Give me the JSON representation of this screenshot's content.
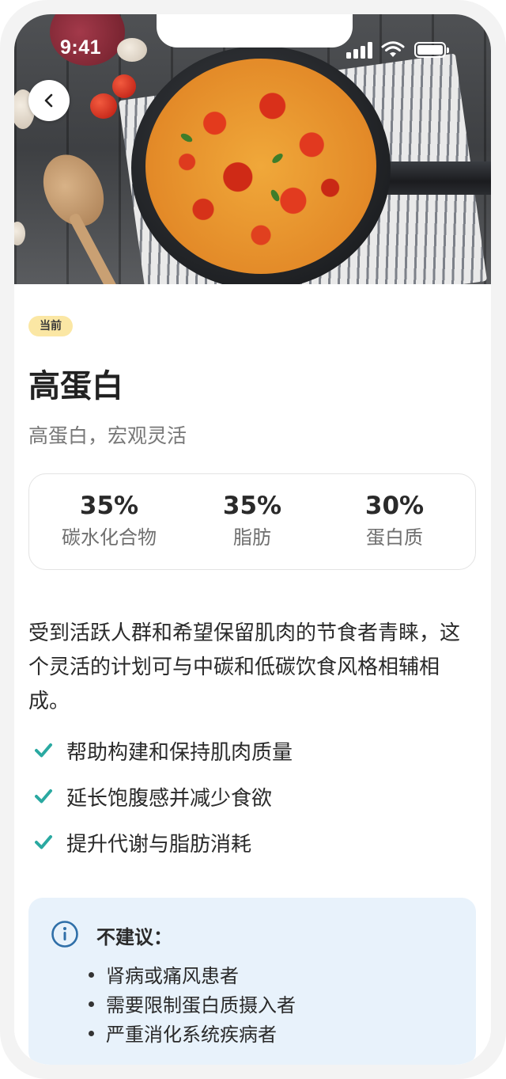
{
  "status_bar": {
    "time": "9:41"
  },
  "hero": {
    "image_alt": "铁锅中的番茄蔬菜烘蛋"
  },
  "plan": {
    "badge": "当前",
    "title": "高蛋白",
    "subtitle": "高蛋白，宏观灵活",
    "macros": [
      {
        "value": "35%",
        "label": "碳水化合物"
      },
      {
        "value": "35%",
        "label": "脂肪"
      },
      {
        "value": "30%",
        "label": "蛋白质"
      }
    ],
    "description": "受到活跃人群和希望保留肌肉的节食者青睐，这个灵活的计划可与中碳和低碳饮食风格相辅相成。",
    "benefits": [
      "帮助构建和保持肌肉质量",
      "延长饱腹感并减少食欲",
      "提升代谢与脂肪消耗"
    ]
  },
  "warning": {
    "title": "不建议：",
    "items": [
      "肾病或痛风患者",
      "需要限制蛋白质摄入者",
      "严重消化系统疾病者"
    ]
  },
  "colors": {
    "badge_bg": "#fbe7a4",
    "check": "#2aa9a1",
    "info_icon": "#2f6fa8",
    "warning_bg": "#e8f2fb"
  },
  "icons": {
    "back": "chevron-left-icon",
    "check": "check-icon",
    "info": "info-circle-icon"
  }
}
